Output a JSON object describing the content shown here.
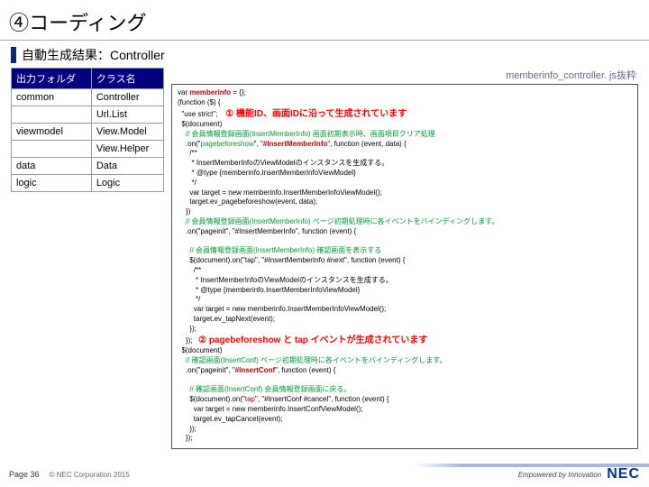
{
  "title": "④コーディング",
  "subtitle": "自動生成結果：Controller",
  "table": {
    "headers": {
      "folder": "出力フォルダ",
      "classname": "クラス名"
    },
    "rows": [
      {
        "folder": "common",
        "classname": "Controller"
      },
      {
        "folder": "",
        "classname": "Url.List"
      },
      {
        "folder": "viewmodel",
        "classname": "View.Model"
      },
      {
        "folder": "",
        "classname": "View.Helper"
      },
      {
        "folder": "data",
        "classname": "Data"
      },
      {
        "folder": "logic",
        "classname": "Logic"
      }
    ]
  },
  "caption": "memberinfo_controller. js抜粋",
  "note1": "① 機能ID、画面IDに沿って生成されています",
  "note2": "② pagebeforeshow と tap イベントが生成されています",
  "code": {
    "l01a": "var ",
    "l01b": "memberinfo",
    "l01c": " = {};",
    "l02": "(function ($) {",
    "l03": "  \"use strict\";",
    "l04": "  $(document)",
    "l05": "    // 会員情報登録画面(InsertMemberInfo) 画面初期表示時、画面項目クリア処理",
    "l06a": "    .on(\"",
    "l06b": "pagebeforeshow",
    "l06c": "\", \"",
    "l06d": "#InsertMemberInfo",
    "l06e": "\", ",
    "l06f": "function (event, data) {",
    "l07": "      /**",
    "l08": "       * InsertMemberInfoのViewModelのインスタンスを生成する。",
    "l09": "       * @type {memberinfo.InsertMemberInfoViewModel}",
    "l10": "       */",
    "l11": "      var target = new memberinfo.InsertMemberInfoViewModel();",
    "l12": "      target.ev_pagebeforeshow(event, data);",
    "l13": "    })",
    "l14": "    // 会員情報登録画面(InsertMemberInfo) ページ初期処理時に各イベントをバインディングします。",
    "l15": "    .on(\"pageinit\", \"#InsertMemberInfo\", function (event) {",
    "l16": "",
    "l17": "      // 会員情報登録画面(InsertMemberInfo) 確認画面を表示する",
    "l18": "      $(document).on(\"tap\", \"#InsertMemberInfo #next\", function (event) {",
    "l19": "        /**",
    "l20": "         * InsertMemberInfoのViewModelのインスタンスを生成する。",
    "l21": "         * @type {memberinfo.InsertMemberInfoViewModel}",
    "l22": "         */",
    "l23": "        var target = new memberinfo.InsertMemberInfoViewModel();",
    "l24": "        target.ev_tapNext(event);",
    "l25": "      });",
    "l26": "    });",
    "l27": "  $(document)",
    "l28": "    // 確認画面(InsertConf) ページ初期処理時に各イベントをバインディングします。",
    "l29a": "    .on(\"pageinit\", \"",
    "l29b": "#InsertConf",
    "l29c": "\", function (event) {",
    "l30": "",
    "l31": "      // 確認画面(InsertConf) 会員情報登録画面に戻る。",
    "l32a": "      $(document).on(\"",
    "l32b": "tap",
    "l32c": "\", \"#InsertConf #cancel\", function (event) {",
    "l33": "        var target = new memberinfo.InsertConfViewModel();",
    "l34": "        target.ev_tapCancel(event);",
    "l35": "      });",
    "l36": "    });"
  },
  "footer": {
    "page": "Page 36",
    "copyright": "© NEC Corporation 2015",
    "tagline": "Empowered by Innovation",
    "logo": "NEC"
  }
}
